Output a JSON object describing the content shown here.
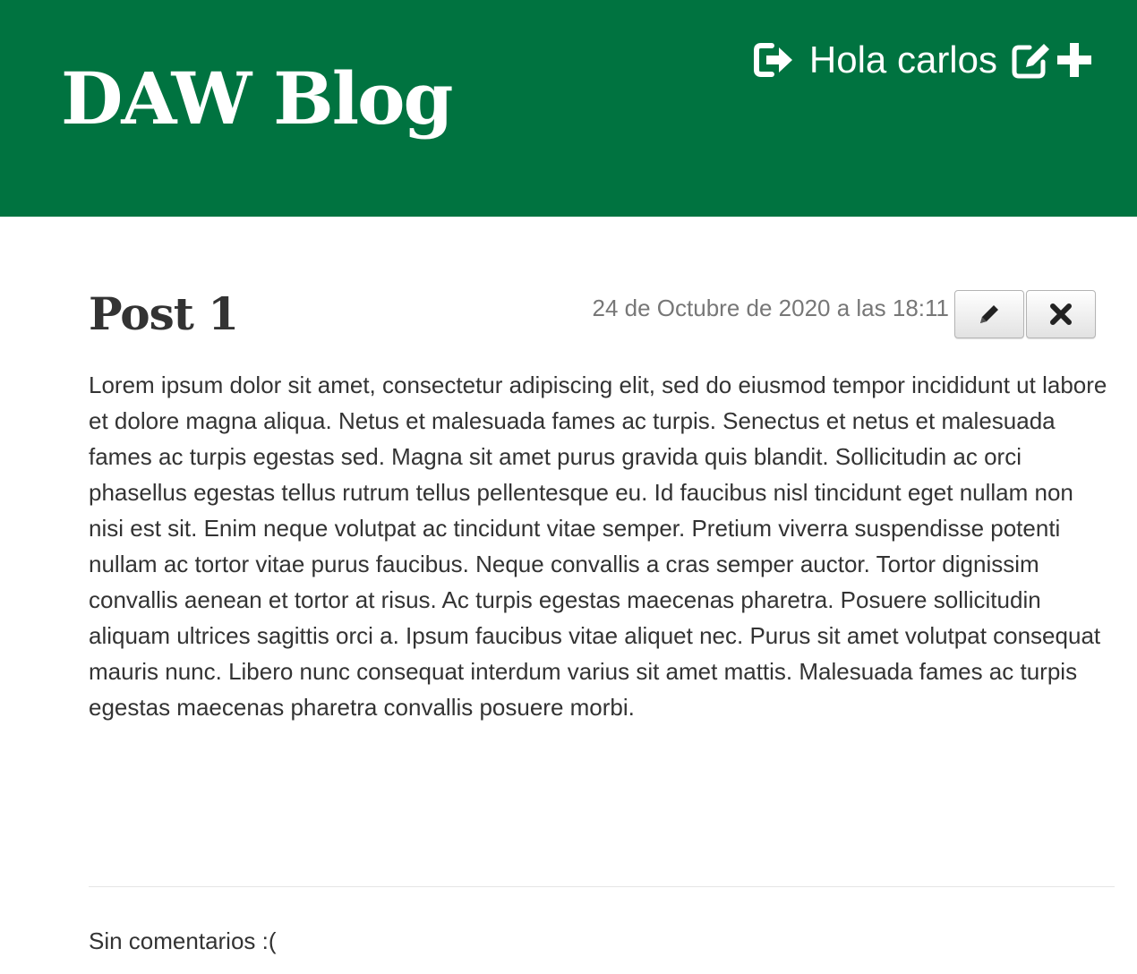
{
  "header": {
    "brand": "DAW Blog",
    "greeting": "Hola carlos",
    "icons": [
      "logout-icon",
      "edit-profile-icon",
      "new-post-icon"
    ],
    "background_color": "#007340"
  },
  "post": {
    "title": "Post 1",
    "date": "24 de Octubre de 2020 a las 18:11",
    "actions": {
      "edit_icon": "pencil-icon",
      "delete_icon": "close-icon"
    },
    "body": "Lorem ipsum dolor sit amet, consectetur adipiscing elit, sed do eiusmod tempor incididunt ut labore et dolore magna aliqua. Netus et malesuada fames ac turpis. Senectus et netus et malesuada fames ac turpis egestas sed. Magna sit amet purus gravida quis blandit. Sollicitudin ac orci phasellus egestas tellus rutrum tellus pellentesque eu. Id faucibus nisl tincidunt eget nullam non nisi est sit. Enim neque volutpat ac tincidunt vitae semper. Pretium viverra suspendisse potenti nullam ac tortor vitae purus faucibus. Neque convallis a cras semper auctor. Tortor dignissim convallis aenean et tortor at risus. Ac turpis egestas maecenas pharetra. Posuere sollicitudin aliquam ultrices sagittis orci a. Ipsum faucibus vitae aliquet nec. Purus sit amet volutpat consequat mauris nunc. Libero nunc consequat interdum varius sit amet mattis. Malesuada fames ac turpis egestas maecenas pharetra convallis posuere morbi."
  },
  "comments": {
    "empty_message": "Sin comentarios :("
  }
}
